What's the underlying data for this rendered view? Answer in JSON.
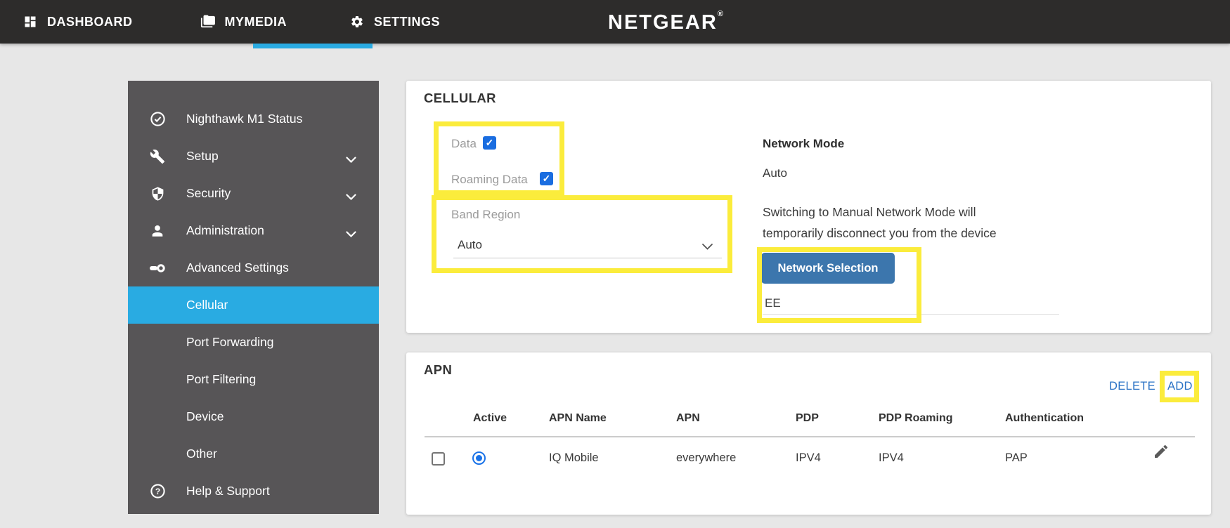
{
  "nav": {
    "items": [
      {
        "label": "DASHBOARD",
        "icon": "dashboard-icon",
        "active": false
      },
      {
        "label": "MYMEDIA",
        "icon": "media-icon",
        "active": false
      },
      {
        "label": "SETTINGS",
        "icon": "gear-icon",
        "active": true
      }
    ],
    "brand": "NETGEAR",
    "brand_reg": "®"
  },
  "sidebar": {
    "items": [
      {
        "label": "Nighthawk M1 Status",
        "icon": "check-circle-icon",
        "expandable": false,
        "active": false
      },
      {
        "label": "Setup",
        "icon": "wrench-icon",
        "expandable": true,
        "active": false
      },
      {
        "label": "Security",
        "icon": "shield-icon",
        "expandable": true,
        "active": false
      },
      {
        "label": "Administration",
        "icon": "person-icon",
        "expandable": true,
        "active": false
      },
      {
        "label": "Advanced Settings",
        "icon": "key-icon",
        "expandable": false,
        "active": false
      },
      {
        "label": "Cellular",
        "icon": "",
        "expandable": false,
        "active": true
      },
      {
        "label": "Port Forwarding",
        "icon": "",
        "expandable": false,
        "active": false
      },
      {
        "label": "Port Filtering",
        "icon": "",
        "expandable": false,
        "active": false
      },
      {
        "label": "Device",
        "icon": "",
        "expandable": false,
        "active": false
      },
      {
        "label": "Other",
        "icon": "",
        "expandable": false,
        "active": false
      },
      {
        "label": "Help & Support",
        "icon": "question-circle-icon",
        "expandable": false,
        "active": false
      }
    ]
  },
  "cellular": {
    "title": "CELLULAR",
    "data_label": "Data",
    "data_checked": true,
    "roaming_label": "Roaming Data",
    "roaming_checked": true,
    "band_region_label": "Band Region",
    "band_region_value": "Auto",
    "network_mode_label": "Network Mode",
    "network_mode_value": "Auto",
    "warning_line1": "Switching to Manual Network Mode will",
    "warning_line2": "temporarily disconnect you from the device",
    "network_selection_button": "Network Selection",
    "current_network": "EE"
  },
  "apn": {
    "title": "APN",
    "delete_label": "DELETE",
    "add_label": "ADD",
    "columns": [
      "Active",
      "APN Name",
      "APN",
      "PDP",
      "PDP Roaming",
      "Authentication"
    ],
    "rows": [
      {
        "selected": false,
        "active": true,
        "apn_name": "IQ Mobile",
        "apn": "everywhere",
        "pdp": "IPV4",
        "pdp_roaming": "IPV4",
        "authentication": "PAP"
      }
    ]
  },
  "colors": {
    "accent_blue": "#29abe2",
    "highlight_yellow": "#fbec3c",
    "button_blue": "#3c76ad",
    "link_blue": "#2a72c5",
    "checkbox_blue": "#1a6de0",
    "nav_bg": "#2d2c2b",
    "sidebar_bg": "#575557"
  }
}
